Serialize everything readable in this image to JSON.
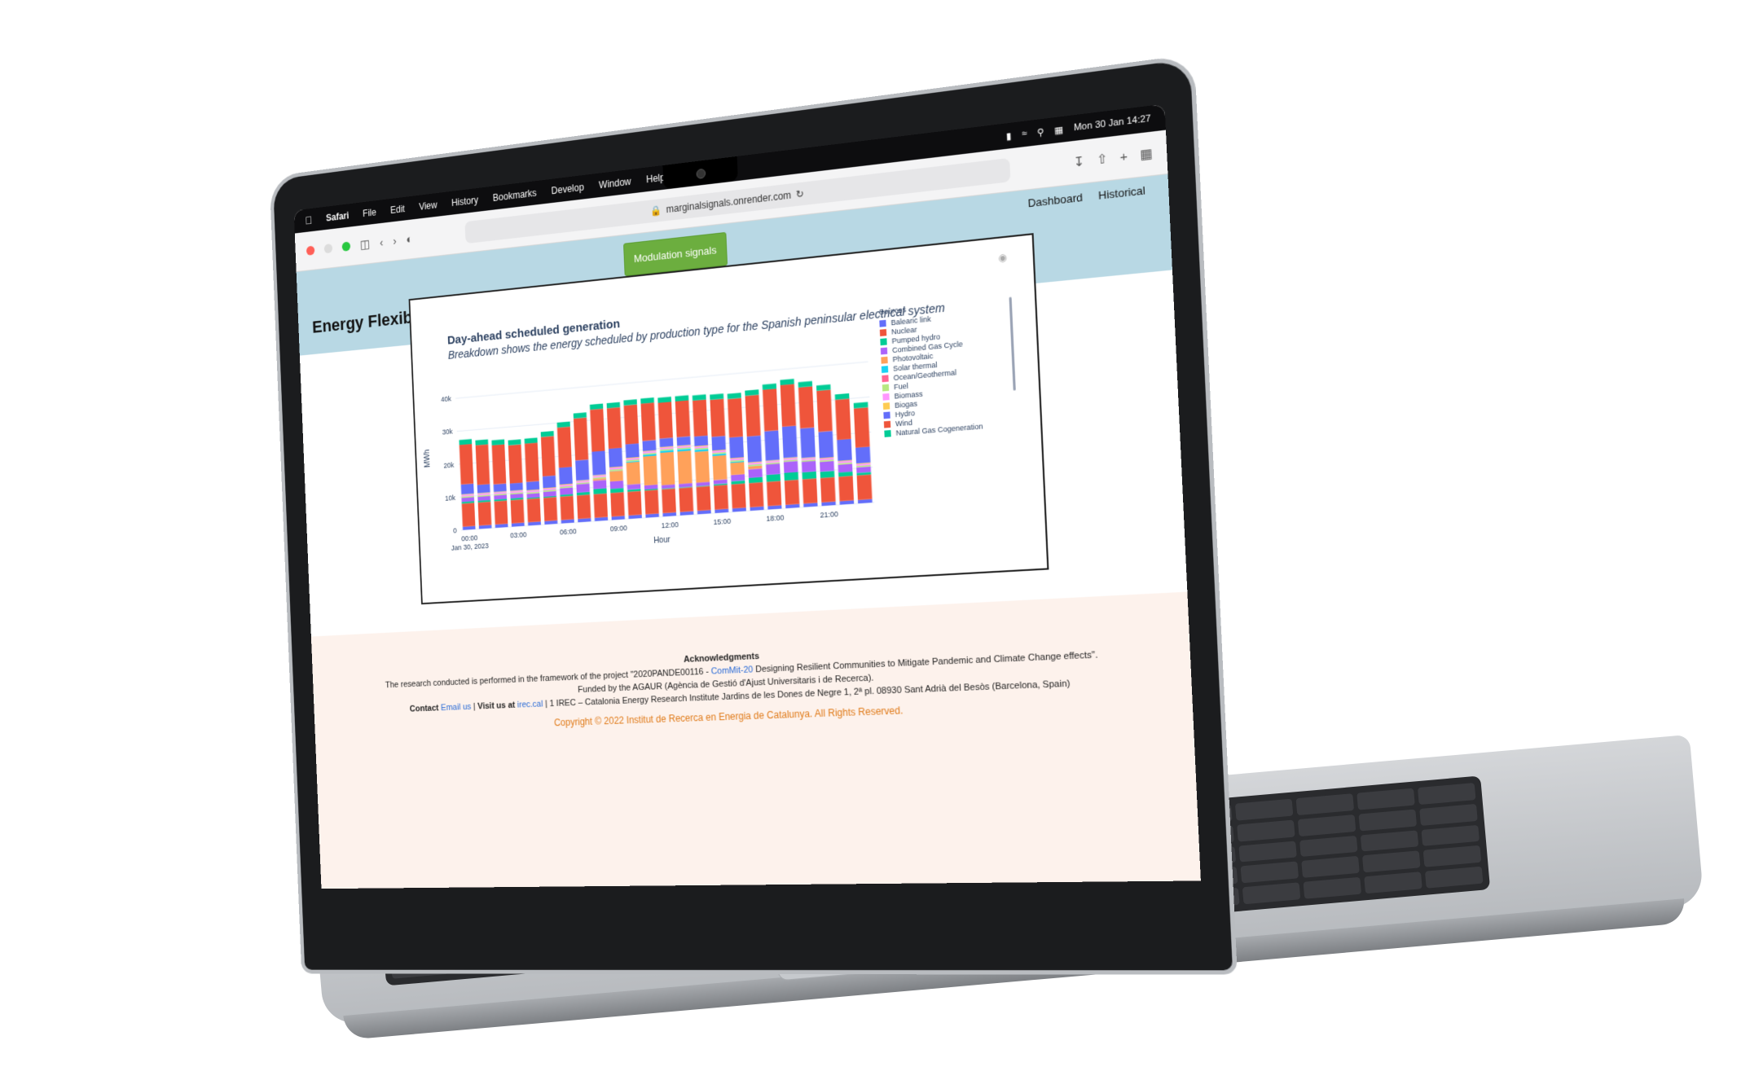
{
  "menubar": {
    "app": "Safari",
    "items": [
      "File",
      "Edit",
      "View",
      "History",
      "Bookmarks",
      "Develop",
      "Window",
      "Help"
    ],
    "clock": "Mon 30 Jan 14:27"
  },
  "browser": {
    "url": "marginalsignals.onrender.com"
  },
  "site": {
    "title": "Energy Flexibility",
    "button": "Modulation signals",
    "nav": [
      "Dashboard",
      "Historical"
    ]
  },
  "chart_data": {
    "type": "bar",
    "title": "Day-ahead scheduled generation",
    "subtitle": "Breakdown shows the energy scheduled by production type for the Spanish peninsular electrical system",
    "xlabel": "Hour",
    "ylabel": "MWh",
    "ylim": [
      0,
      45000
    ],
    "yticks": [
      "0",
      "10k",
      "20k",
      "30k",
      "40k"
    ],
    "xticks": [
      "00:00",
      "03:00",
      "06:00",
      "09:00",
      "12:00",
      "15:00",
      "18:00",
      "21:00"
    ],
    "xdate": "Jan 30, 2023",
    "categories": [
      "00",
      "01",
      "02",
      "03",
      "04",
      "05",
      "06",
      "07",
      "08",
      "09",
      "10",
      "11",
      "12",
      "13",
      "14",
      "15",
      "16",
      "17",
      "18",
      "19",
      "20",
      "21",
      "22",
      "23"
    ],
    "legend_title": "Sources",
    "series": [
      {
        "name": "Balearic link",
        "color": "#636efa",
        "values": [
          1000,
          1000,
          1000,
          1000,
          1000,
          1000,
          1000,
          1000,
          1000,
          1000,
          1000,
          1000,
          1000,
          1000,
          1000,
          1000,
          1000,
          1000,
          1000,
          1000,
          1000,
          1000,
          1000,
          1000
        ]
      },
      {
        "name": "Nuclear",
        "color": "#ef553b",
        "values": [
          7000,
          7000,
          7000,
          7000,
          7000,
          7000,
          7000,
          7000,
          7000,
          7000,
          7000,
          7000,
          7000,
          7000,
          7000,
          7000,
          7000,
          7000,
          7000,
          7000,
          7000,
          7000,
          7000,
          7000
        ]
      },
      {
        "name": "Pumped hydro",
        "color": "#00cc96",
        "values": [
          500,
          500,
          500,
          500,
          300,
          300,
          500,
          800,
          1500,
          1200,
          600,
          300,
          200,
          200,
          200,
          400,
          900,
          1500,
          2000,
          2200,
          2000,
          1800,
          1200,
          700
        ]
      },
      {
        "name": "Combined Gas Cycle",
        "color": "#ab63fa",
        "values": [
          1200,
          1200,
          1200,
          1200,
          1200,
          1500,
          2000,
          2500,
          2500,
          2200,
          1500,
          1200,
          1000,
          1000,
          1000,
          1200,
          1800,
          2500,
          3000,
          3200,
          3000,
          2800,
          2200,
          1600
        ]
      },
      {
        "name": "Photovoltaic",
        "color": "#ffa15a",
        "values": [
          0,
          0,
          0,
          0,
          0,
          0,
          0,
          0,
          500,
          3000,
          6500,
          8500,
          9500,
          9500,
          9000,
          7000,
          3500,
          800,
          0,
          0,
          0,
          0,
          0,
          0
        ]
      },
      {
        "name": "Solar thermal",
        "color": "#19d3f3",
        "values": [
          0,
          0,
          0,
          0,
          0,
          0,
          0,
          0,
          0,
          100,
          300,
          500,
          600,
          600,
          600,
          500,
          300,
          100,
          0,
          0,
          0,
          0,
          0,
          0
        ]
      },
      {
        "name": "Ocean/Geothermal",
        "color": "#ff6692",
        "values": [
          0,
          0,
          0,
          0,
          0,
          0,
          0,
          0,
          0,
          0,
          0,
          0,
          0,
          0,
          0,
          0,
          0,
          0,
          0,
          0,
          0,
          0,
          0,
          0
        ]
      },
      {
        "name": "Fuel",
        "color": "#b6e880",
        "values": [
          400,
          400,
          400,
          400,
          400,
          400,
          400,
          400,
          400,
          400,
          400,
          400,
          400,
          400,
          400,
          400,
          400,
          400,
          400,
          400,
          400,
          400,
          400,
          400
        ]
      },
      {
        "name": "Biomass",
        "color": "#ff97ff",
        "values": [
          500,
          500,
          500,
          500,
          500,
          500,
          500,
          500,
          500,
          500,
          500,
          500,
          500,
          500,
          500,
          500,
          500,
          500,
          500,
          500,
          500,
          500,
          500,
          500
        ]
      },
      {
        "name": "Biogas",
        "color": "#fecb52",
        "values": [
          200,
          200,
          200,
          200,
          200,
          200,
          200,
          200,
          200,
          200,
          200,
          200,
          200,
          200,
          200,
          200,
          200,
          200,
          200,
          200,
          200,
          200,
          200,
          200
        ]
      },
      {
        "name": "Hydro",
        "color": "#636efa",
        "values": [
          3000,
          2500,
          2300,
          2200,
          2500,
          3500,
          5000,
          6000,
          7000,
          5500,
          4000,
          3000,
          2500,
          2500,
          2800,
          4000,
          6000,
          7500,
          8500,
          9000,
          8500,
          7500,
          6000,
          4500
        ]
      },
      {
        "name": "Wind",
        "color": "#ef553b",
        "values": [
          12000,
          12000,
          11800,
          11500,
          11500,
          11800,
          12000,
          12500,
          12500,
          12000,
          11500,
          11000,
          10500,
          10500,
          10500,
          10800,
          11200,
          11800,
          12000,
          12000,
          11800,
          11800,
          11500,
          11200
        ]
      },
      {
        "name": "Natural Gas Cogeneration",
        "color": "#00cc96",
        "values": [
          1500,
          1500,
          1500,
          1500,
          1500,
          1500,
          1500,
          1500,
          1500,
          1500,
          1500,
          1500,
          1500,
          1500,
          1500,
          1500,
          1500,
          1500,
          1500,
          1500,
          1500,
          1500,
          1500,
          1500
        ]
      }
    ]
  },
  "acknowledgments": {
    "title": "Acknowledgments",
    "line1": "The research conducted is performed in the framework of the project \"2020PANDE00116 - ",
    "project_link": "ComMit-20",
    "line1_end": " Designing Resilient Communities to Mitigate Pandemic and Climate Change effects\".",
    "line2": "Funded by the AGAUR (Agència de Gestió d'Ajust Universitaris i de Recerca).",
    "contact_label": "Contact",
    "email_link": "Email us",
    "visit_label": "Visit us at",
    "site_link": "irec.cal",
    "address": "1 IREC – Catalonia Energy Research Institute Jardins de les Dones de Negre 1, 2ª pl. 08930 Sant Adrià del Besòs (Barcelona, Spain)",
    "copyright": "Copyright © 2022 Institut de Recerca en Energia de Catalunya. All Rights Reserved."
  }
}
